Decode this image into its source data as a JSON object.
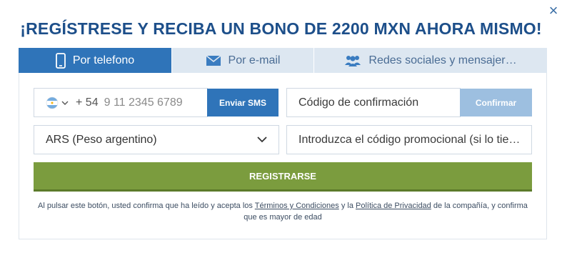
{
  "title": "¡REGÍSTRESE Y RECIBA UN BONO DE 2200 MXN AHORA MISMO!",
  "close_symbol": "×",
  "tabs": [
    {
      "label": "Por telefono",
      "icon": "phone-icon",
      "active": true
    },
    {
      "label": "Por e-mail",
      "icon": "envelope-icon",
      "active": false
    },
    {
      "label": "Redes sociales y mensajer…",
      "icon": "users-icon",
      "active": false
    }
  ],
  "phone": {
    "country_flag": "argentina-flag-icon",
    "dial_code": "+ 54",
    "placeholder": "9 11 2345 6789",
    "send_sms_label": "Enviar SMS"
  },
  "confirmation": {
    "placeholder": "Código de confirmación",
    "confirm_label": "Confirmar"
  },
  "currency": {
    "selected": "ARS (Peso argentino)"
  },
  "promo": {
    "placeholder": "Introduzca el código promocional (si lo tie…"
  },
  "register_label": "REGISTRARSE",
  "terms": {
    "prefix": "Al pulsar este botón, usted confirma que ha leído y acepta los",
    "terms_link": "Términos y Condiciones",
    "middle": "y la",
    "privacy_link": "Política de Privacidad",
    "suffix": "de la compañía, y confirma que es mayor de edad"
  },
  "colors": {
    "title": "#1d4f8a",
    "tab_active": "#2f74b9",
    "tab_inactive": "#dde7f1",
    "send_sms": "#2f74b9",
    "confirm": "#9dbfe0",
    "register": "#7b9c3e"
  }
}
